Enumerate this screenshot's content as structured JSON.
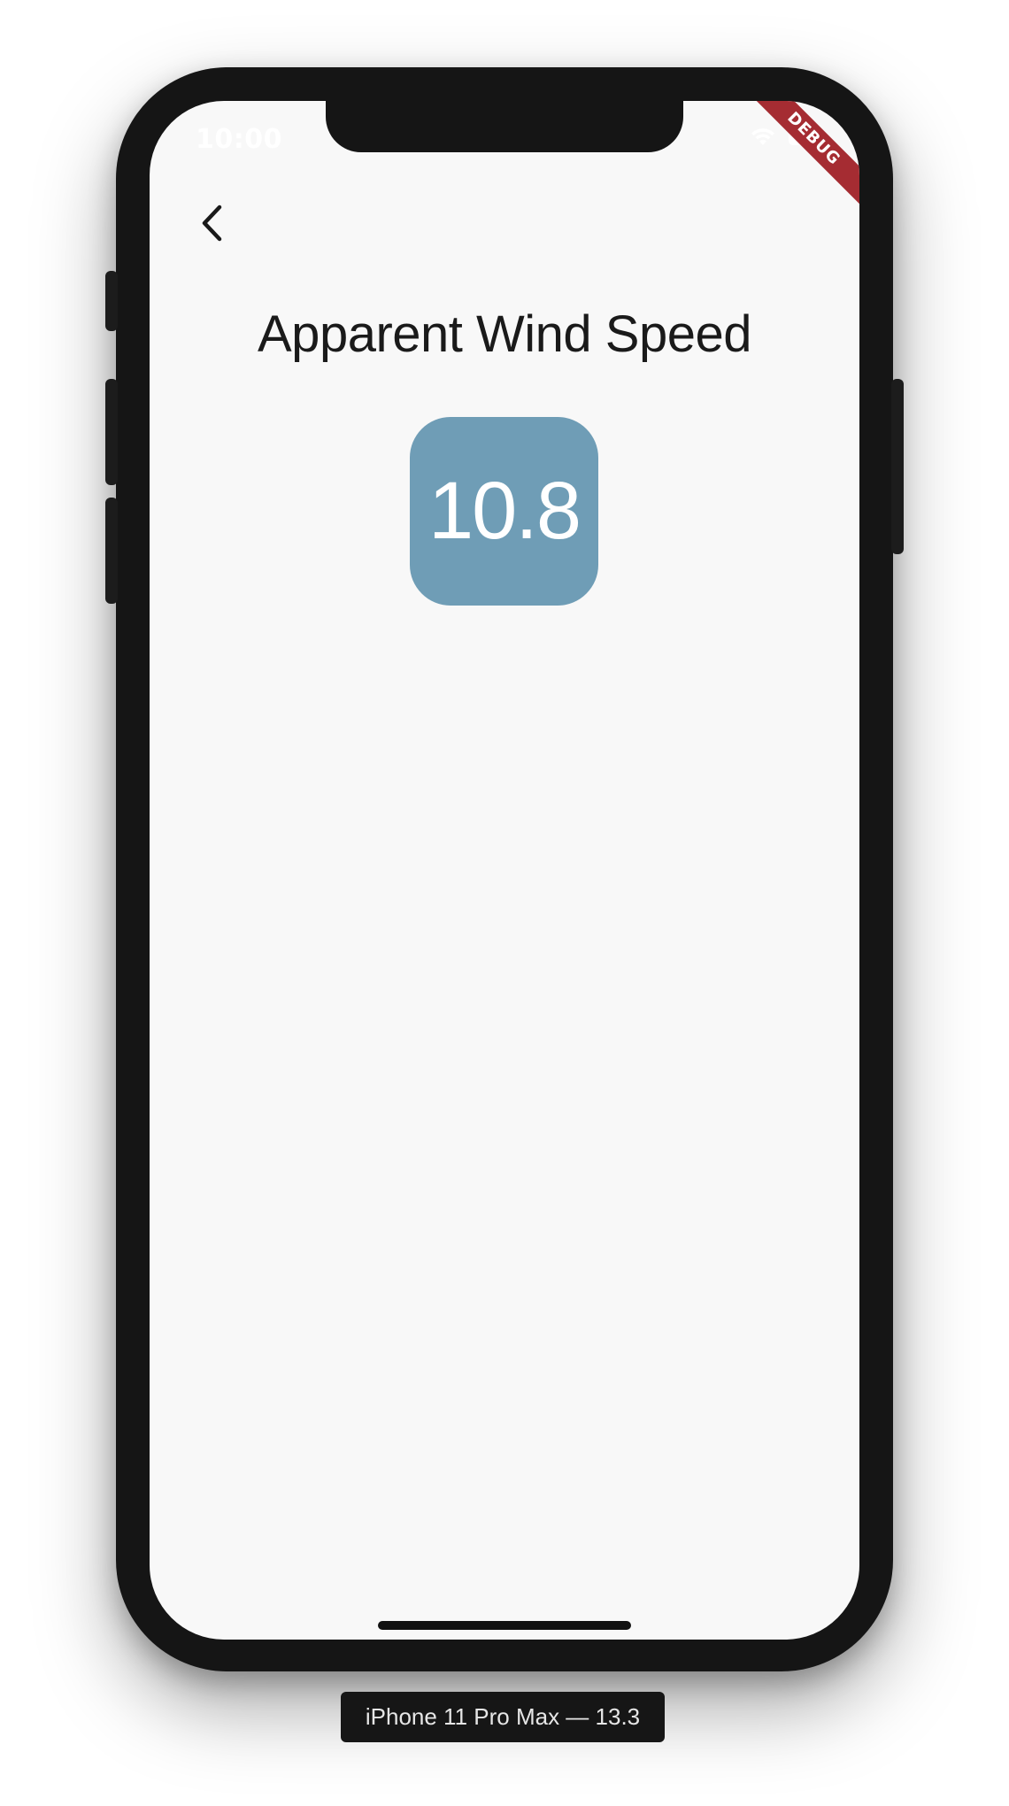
{
  "status_bar": {
    "time": "10:00"
  },
  "debug_banner": {
    "label": "DEBUG",
    "color": "#a52c32"
  },
  "nav": {
    "back_icon": "chevron-left-icon"
  },
  "page": {
    "title": "Apparent Wind Speed",
    "value": "10.8",
    "tile_color": "#6f9db6"
  },
  "simulator": {
    "device_label": "iPhone 11 Pro Max — 13.3"
  }
}
